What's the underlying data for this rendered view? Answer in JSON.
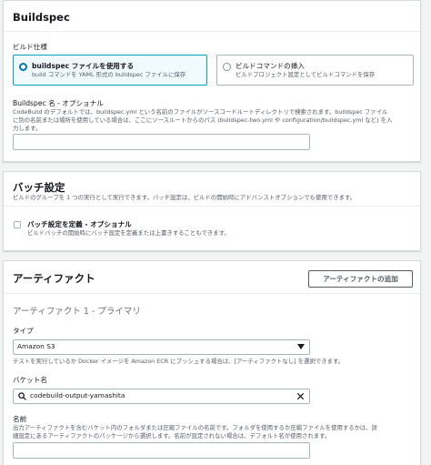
{
  "buildspec": {
    "title": "Buildspec",
    "settings_label": "ビルド仕様",
    "options": [
      {
        "title": "buildspec ファイルを使用する",
        "desc": "build コマンドを YAML 形式の buildspec ファイルに保存",
        "selected": true
      },
      {
        "title": "ビルドコマンドの挿入",
        "desc": "ビルドプロジェクト設定としてビルドコマンドを保存",
        "selected": false
      }
    ],
    "name_label": "Buildspec 名 - オプショナル",
    "name_desc_1": "CodeBuild のデフォルトでは、buildspec.yml という名前のファイルがソースコードルートディレクトリで検索されます。buildspec ファイル",
    "name_desc_2": "に別の名前または場所を使用している場合は、ここにソースルートからのパス (buildspec-two.yml や configuration/buildspec.yml など) を入",
    "name_desc_3": "力します。",
    "name_value": ""
  },
  "batch": {
    "title": "バッチ設定",
    "desc": "ビルドのグループを 1 つの実行として実行できます。バッチ設定は、ビルドの開始時にアドバンストオプションでも使用できます。",
    "checkbox_label": "バッチ設定を定義 - オプショナル",
    "checkbox_desc": "ビルドバッチの開始時にバッチ設定を定義または上書きすることもできます。"
  },
  "artifacts": {
    "title": "アーティファクト",
    "add_button": "アーティファクトの追加",
    "subtitle": "アーティファクト 1 - プライマリ",
    "type_label": "タイプ",
    "type_value": "Amazon S3",
    "type_desc": "テストを実行しているか Docker イメージを Amazon ECR にプッシュする場合は、[アーティファクトなし] を選択できます。",
    "bucket_label": "バケット名",
    "bucket_value": "codebuild-output-yamashita",
    "name_label": "名前",
    "name_desc_1": "出力アーティファクトを含むバケット内のフォルダまたは圧縮ファイルの名前です。フォルダを使用するか圧縮ファイルを使用するかは、詳",
    "name_desc_2": "細設定にあるアーティファクトのパッケージから選択します。名前が設定されない場合は、デフォルト名が使用されます。",
    "name_value": ""
  },
  "colors": {
    "accent": "#0073bb",
    "selected_border": "#00a1c9",
    "selected_bg": "#f1faff",
    "page_bg": "#f2f3f3"
  }
}
